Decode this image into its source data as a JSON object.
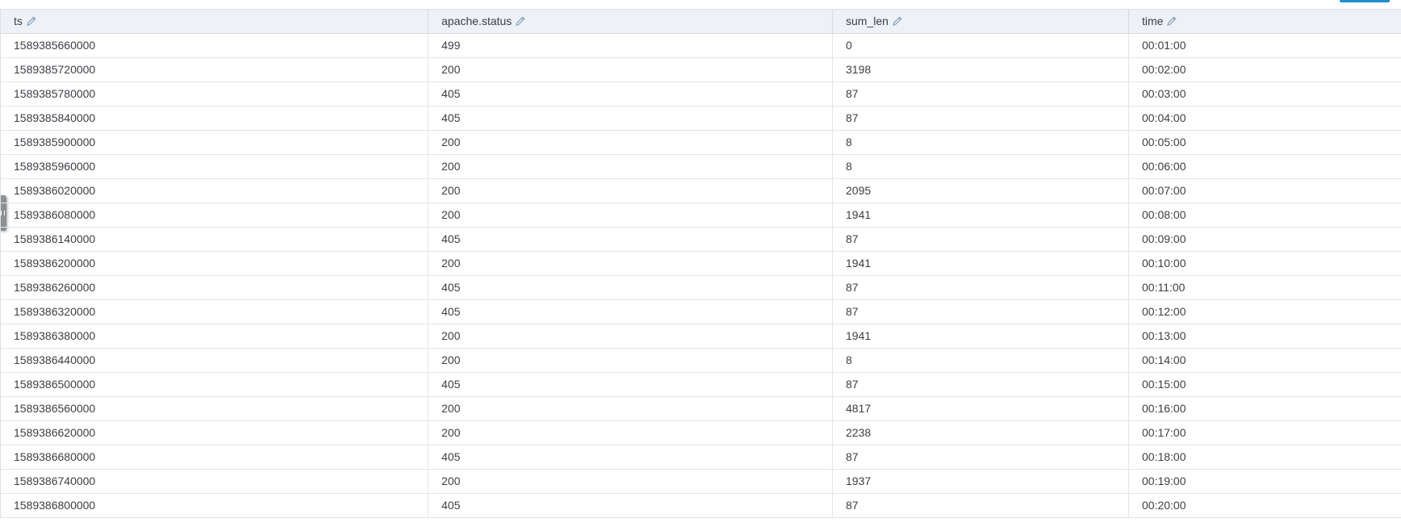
{
  "columns": [
    {
      "label": "ts",
      "icon": "pencil-icon"
    },
    {
      "label": "apache.status",
      "icon": "pencil-icon"
    },
    {
      "label": "sum_len",
      "icon": "pencil-icon"
    },
    {
      "label": "time",
      "icon": "pencil-icon"
    }
  ],
  "rows": [
    [
      "1589385660000",
      "499",
      "0",
      "00:01:00"
    ],
    [
      "1589385720000",
      "200",
      "3198",
      "00:02:00"
    ],
    [
      "1589385780000",
      "405",
      "87",
      "00:03:00"
    ],
    [
      "1589385840000",
      "405",
      "87",
      "00:04:00"
    ],
    [
      "1589385900000",
      "200",
      "8",
      "00:05:00"
    ],
    [
      "1589385960000",
      "200",
      "8",
      "00:06:00"
    ],
    [
      "1589386020000",
      "200",
      "2095",
      "00:07:00"
    ],
    [
      "1589386080000",
      "200",
      "1941",
      "00:08:00"
    ],
    [
      "1589386140000",
      "405",
      "87",
      "00:09:00"
    ],
    [
      "1589386200000",
      "200",
      "1941",
      "00:10:00"
    ],
    [
      "1589386260000",
      "405",
      "87",
      "00:11:00"
    ],
    [
      "1589386320000",
      "405",
      "87",
      "00:12:00"
    ],
    [
      "1589386380000",
      "200",
      "1941",
      "00:13:00"
    ],
    [
      "1589386440000",
      "200",
      "8",
      "00:14:00"
    ],
    [
      "1589386500000",
      "405",
      "87",
      "00:15:00"
    ],
    [
      "1589386560000",
      "200",
      "4817",
      "00:16:00"
    ],
    [
      "1589386620000",
      "200",
      "2238",
      "00:17:00"
    ],
    [
      "1589386680000",
      "405",
      "87",
      "00:18:00"
    ],
    [
      "1589386740000",
      "200",
      "1937",
      "00:19:00"
    ],
    [
      "1589386800000",
      "405",
      "87",
      "00:20:00"
    ]
  ],
  "colors": {
    "header_bg": "#eef1f5",
    "accent": "#1f8fd1",
    "edit_icon": "#8aa4bf"
  }
}
